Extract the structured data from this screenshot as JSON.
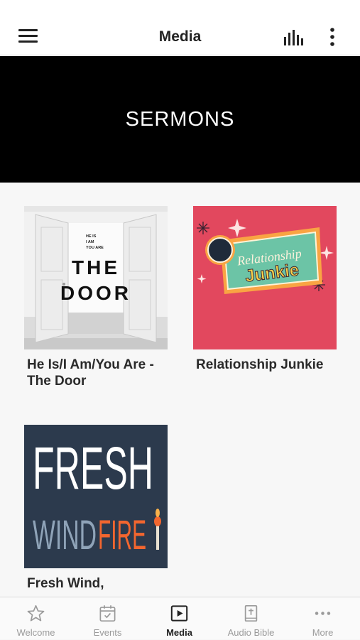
{
  "header": {
    "title": "Media"
  },
  "banner": {
    "title": "SERMONS"
  },
  "items": [
    {
      "title": "He Is/I Am/You Are - The Door",
      "art": {
        "small_text_lines": [
          "HE IS",
          "I AM",
          "YOU ARE"
        ],
        "big_line_1": "THE",
        "big_line_2": "DOOR"
      }
    },
    {
      "title": "Relationship Junkie",
      "art": {
        "script_text": "Relationship",
        "bold_text": "Junkie",
        "background": "#e2485e"
      }
    },
    {
      "title": "Fresh Wind,",
      "art": {
        "word_1": "FRESH",
        "word_2a": "WIND",
        "word_2b": "FIRE",
        "background": "#2c3a4d"
      }
    }
  ],
  "tabs": [
    {
      "label": "Welcome",
      "icon": "star-icon"
    },
    {
      "label": "Events",
      "icon": "calendar-icon"
    },
    {
      "label": "Media",
      "icon": "play-icon",
      "active": true
    },
    {
      "label": "Audio Bible",
      "icon": "bible-icon"
    },
    {
      "label": "More",
      "icon": "more-dots-icon"
    }
  ]
}
